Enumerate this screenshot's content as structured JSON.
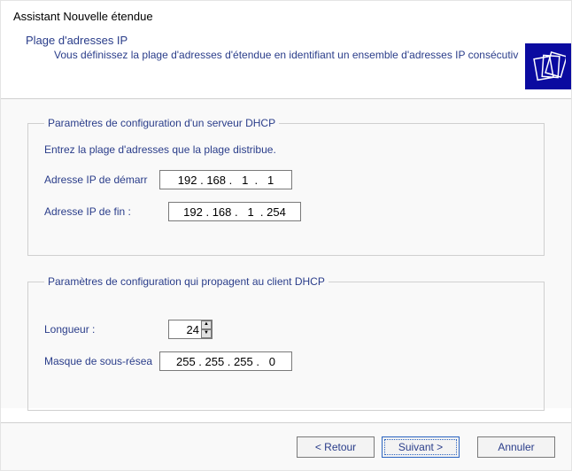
{
  "window_title": "Assistant Nouvelle étendue",
  "header": {
    "subtitle": "Plage d'adresses IP",
    "description": "Vous définissez la plage d'adresses d'étendue en identifiant un ensemble d'adresses IP consécutiv"
  },
  "group_dhcp_server": {
    "legend": "Paramètres de configuration d'un serveur DHCP",
    "instruction": "Entrez la plage d'adresses que la plage distribue.",
    "start_label": "Adresse IP de démarr",
    "start_value": "192 . 168 .   1  .   1",
    "end_label": "Adresse IP de fin :",
    "end_value": "192 . 168 .   1  . 254"
  },
  "group_dhcp_client": {
    "legend": "Paramètres de configuration qui propagent au client DHCP",
    "length_label": "Longueur :",
    "length_value": "24",
    "mask_label": "Masque de sous-résea",
    "mask_value": "255 . 255 . 255 .   0"
  },
  "footer": {
    "back": "< Retour",
    "next": "Suivant >",
    "cancel": "Annuler"
  }
}
